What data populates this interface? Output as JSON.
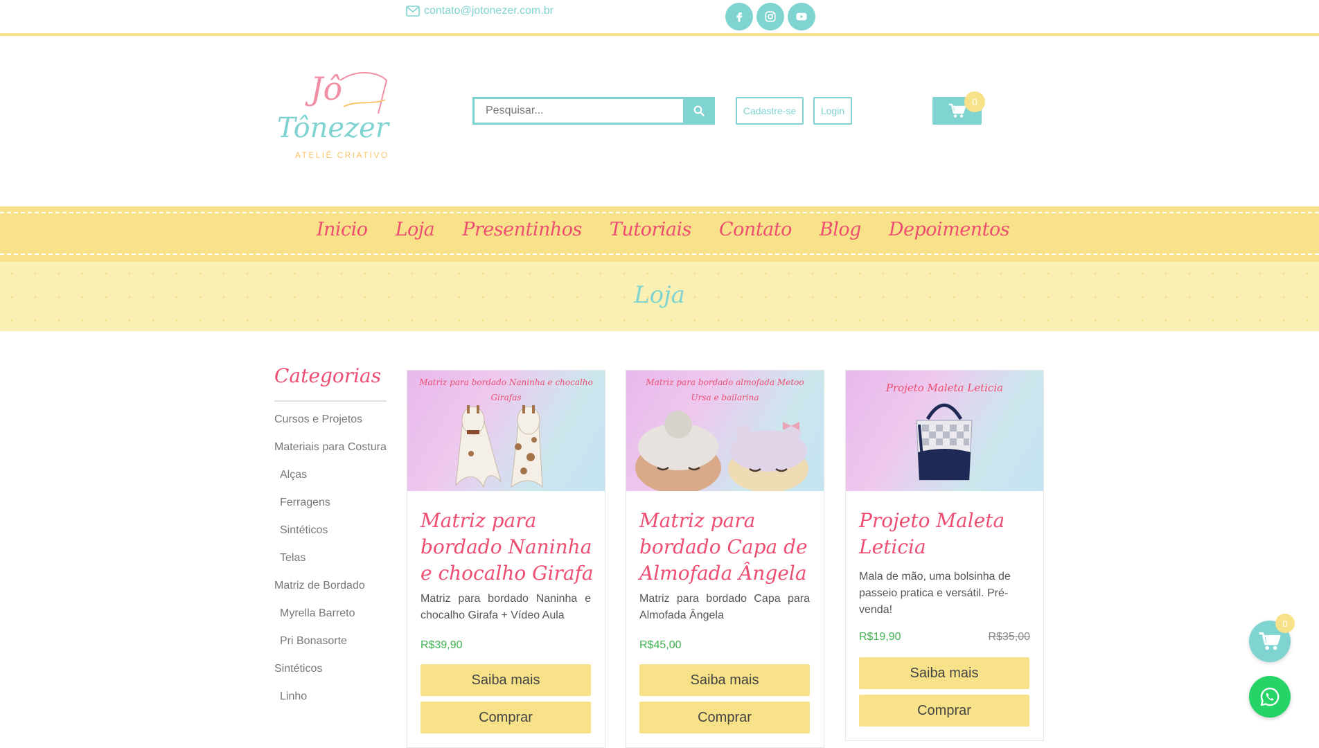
{
  "topbar": {
    "email": "contato@jotonezer.com.br",
    "social_icons": [
      "facebook-icon",
      "instagram-icon",
      "youtube-icon"
    ]
  },
  "header": {
    "logo": {
      "line1": "Jô",
      "line2": "Tônezer",
      "tagline": "ATELIÊ CRIATIVO"
    },
    "search_placeholder": "Pesquisar...",
    "signup_label": "Cadastre-se",
    "login_label": "Login",
    "cart_count": "0"
  },
  "nav": {
    "items": [
      "Inicio",
      "Loja",
      "Presentinhos",
      "Tutoriais",
      "Contato",
      "Blog",
      "Depoimentos"
    ]
  },
  "page_title": "Loja",
  "sidebar": {
    "title": "Categorias",
    "categories": [
      {
        "label": "Cursos e Projetos",
        "sub": false
      },
      {
        "label": "Materiais para Costura",
        "sub": false
      },
      {
        "label": "Alças",
        "sub": true
      },
      {
        "label": "Ferragens",
        "sub": true
      },
      {
        "label": "Sintéticos",
        "sub": true
      },
      {
        "label": "Telas",
        "sub": true
      },
      {
        "label": "Matriz de Bordado",
        "sub": false
      },
      {
        "label": "Myrella Barreto",
        "sub": true
      },
      {
        "label": "Pri Bonasorte",
        "sub": true
      },
      {
        "label": "Sintéticos",
        "sub": false
      },
      {
        "label": "Linho",
        "sub": true
      }
    ]
  },
  "products": [
    {
      "image_caption": [
        "Matriz para bordado Naninha e chocalho",
        "Girafas"
      ],
      "title": "Matriz para bordado Naninha e chocalho Girafa",
      "description": "Matriz para bordado Naninha e chocalho Girafa + Vídeo Aula",
      "price": "R$39,90",
      "old_price": "",
      "details_label": "Saiba mais",
      "buy_label": "Comprar"
    },
    {
      "image_caption": [
        "Matriz para bordado almofada Metoo",
        "Ursa e bailarina"
      ],
      "title": "Matriz para bordado Capa de Almofada Ângela",
      "description": "Matriz para bordado Capa para Almofada Ângela",
      "price": "R$45,00",
      "old_price": "",
      "details_label": "Saiba mais",
      "buy_label": "Comprar"
    },
    {
      "image_caption": [
        "Projeto Maleta Leticia"
      ],
      "title": "Projeto Maleta Leticia",
      "description": "Mala de mão, uma bolsinha de passeio pratica e versátil. Pré-venda!",
      "price": "R$19,90",
      "old_price": "R$35,00",
      "details_label": "Saiba mais",
      "buy_label": "Comprar"
    }
  ],
  "floating": {
    "cart_count": "0"
  },
  "colors": {
    "accent": "#7fd3d0",
    "pink": "#ec4d70",
    "yellow": "#f7e28a",
    "price": "#3fb34f"
  }
}
